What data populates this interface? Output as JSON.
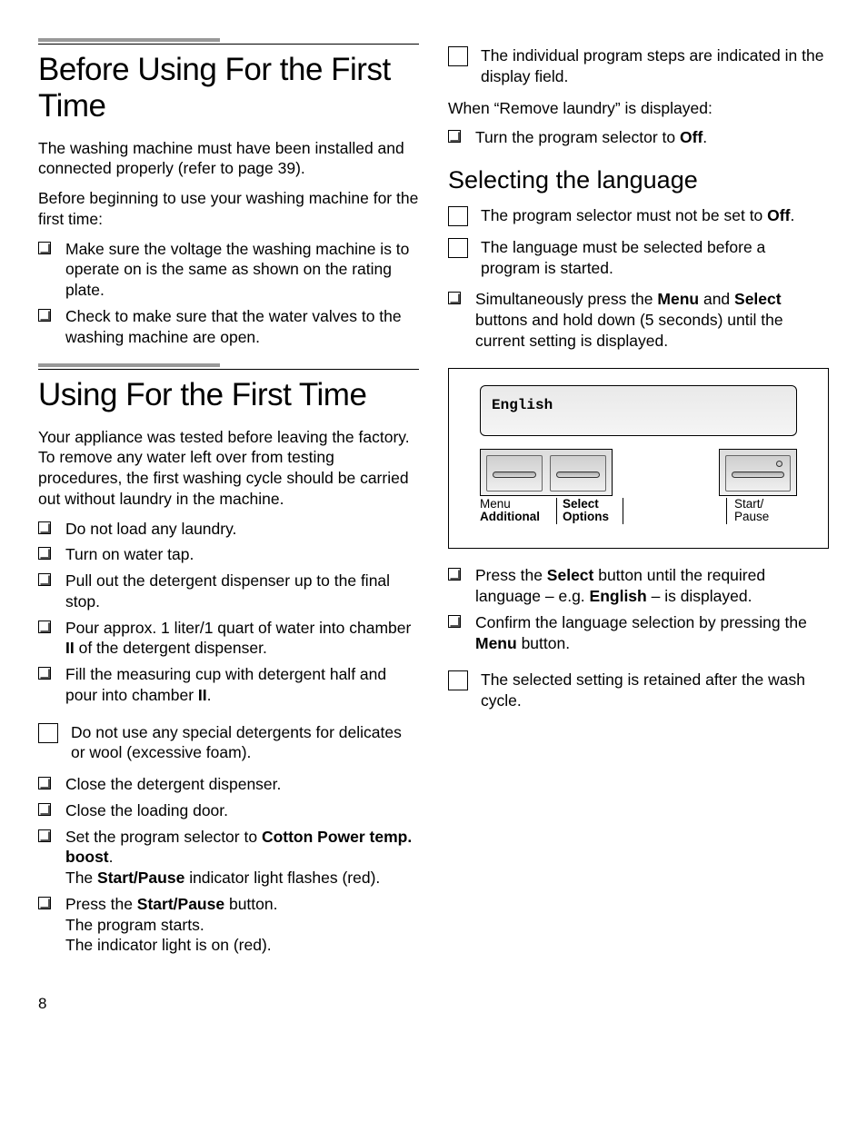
{
  "page_number": "8",
  "left": {
    "section1": {
      "heading": "Before Using For the First Time",
      "p1": "The washing machine must have been installed and connected properly (refer to page 39).",
      "p2": "Before beginning to use your washing machine for the first time:",
      "items": [
        "Make sure the voltage the washing machine is to operate on is the same as shown on the rating plate.",
        "Check to make sure that the water valves to the washing machine are open."
      ]
    },
    "section2": {
      "heading": "Using For the First Time",
      "p1": "Your appliance was tested before leaving the factory. To remove any water left over from testing procedures, the first washing cycle should be carried out without laundry in the machine.",
      "i1": "Do not load any laundry.",
      "i2": "Turn on water tap.",
      "i3": "Pull out the detergent dispenser up to the final stop.",
      "i4a": "Pour approx. 1 liter/1 quart of water into chamber ",
      "i4b": "II",
      "i4c": " of the detergent dispenser.",
      "i5a": "Fill the measuring cup with detergent half and pour into chamber ",
      "i5b": "II",
      "i5c": ".",
      "note1": "Do not use any special detergents for delicates or wool (excessive foam).",
      "i6": "Close the detergent dispenser.",
      "i7": "Close the loading door.",
      "i8a": "Set the program selector to ",
      "i8b": "Cotton Power temp. boost",
      "i8c": ".",
      "i8d1": "The ",
      "i8d2": "Start/Pause",
      "i8d3": " indicator light flashes (red).",
      "i9a": "Press the ",
      "i9b": "Start/Pause",
      "i9c": " button.",
      "i9d": "The program starts.",
      "i9e": "The indicator light is on (red)."
    }
  },
  "right": {
    "noteTop": "The individual program steps are indicated in the display field.",
    "p1": "When “Remove laundry” is displayed:",
    "r1a": "Turn the program selector to ",
    "r1b": "Off",
    "r1c": ".",
    "lang": {
      "heading": "Selecting the language",
      "note1a": "The program selector must not be set to ",
      "note1b": "Off",
      "note1c": ".",
      "note2": "The language must be selected before a program is started.",
      "l1a": "Simultaneously press the ",
      "l1b": "Menu",
      "l1c": " and ",
      "l1d": "Select",
      "l1e": " buttons and hold down (5 seconds) until the current setting is displayed.",
      "l2a": "Press the ",
      "l2b": "Select",
      "l2c": " button until the required language – e.g. ",
      "l2d": "English",
      "l2e": " – is displayed.",
      "l3a": "Confirm the language selection by pressing the ",
      "l3b": "Menu",
      "l3c": " button.",
      "note3": "The selected setting is retained after the wash cycle."
    },
    "diagram": {
      "display": "English",
      "menu1": "Menu",
      "menu2": "Additional",
      "select1": "Select",
      "select2": "Options",
      "start1": "Start/",
      "start2": "Pause"
    }
  }
}
